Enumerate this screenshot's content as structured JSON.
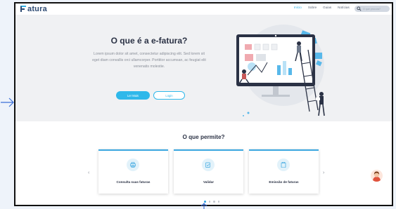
{
  "brand": {
    "name": "atura"
  },
  "nav": {
    "links": [
      "Início",
      "Sobre",
      "Guias",
      "Notícias",
      "Login"
    ],
    "search_placeholder": "O que procura?"
  },
  "hero": {
    "title": "O que é a e-fatura?",
    "text": "Lorem ipsum dolor sit amet, consectetur adipiscing elit. Sed lorem sit eget diam convallis orci ullamcorper. Porttitor accumsan, ac feugiat elit venenatis molestie.",
    "primary_button": "Ler Mais",
    "secondary_button": "Login"
  },
  "features": {
    "title": "O que permite?",
    "cards": [
      {
        "label": "Consulta suas faturas",
        "icon": "printer-icon"
      },
      {
        "label": "Validar",
        "icon": "edit-check-icon"
      },
      {
        "label": "Emissão de faturas",
        "icon": "clipboard-icon"
      }
    ],
    "carousel_page": 1,
    "carousel_total": 4
  },
  "colors": {
    "accent": "#2fb8ea",
    "heading": "#2b3245",
    "hero_bg": "#f0f1f3",
    "card_border": "#3aa6e0"
  }
}
